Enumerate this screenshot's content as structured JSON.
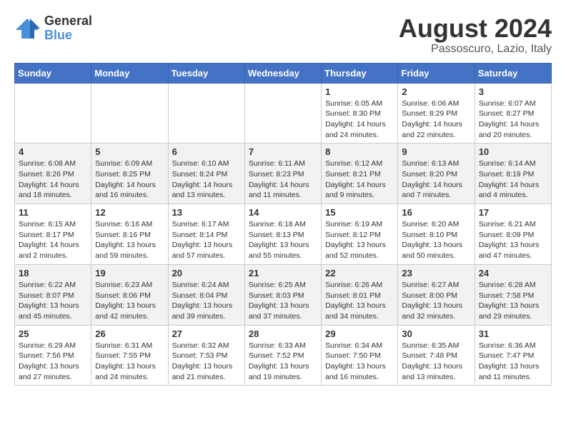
{
  "logo": {
    "general": "General",
    "blue": "Blue"
  },
  "title": "August 2024",
  "location": "Passoscuro, Lazio, Italy",
  "weekdays": [
    "Sunday",
    "Monday",
    "Tuesday",
    "Wednesday",
    "Thursday",
    "Friday",
    "Saturday"
  ],
  "weeks": [
    [
      {
        "day": "",
        "info": ""
      },
      {
        "day": "",
        "info": ""
      },
      {
        "day": "",
        "info": ""
      },
      {
        "day": "",
        "info": ""
      },
      {
        "day": "1",
        "info": "Sunrise: 6:05 AM\nSunset: 8:30 PM\nDaylight: 14 hours and 24 minutes."
      },
      {
        "day": "2",
        "info": "Sunrise: 6:06 AM\nSunset: 8:29 PM\nDaylight: 14 hours and 22 minutes."
      },
      {
        "day": "3",
        "info": "Sunrise: 6:07 AM\nSunset: 8:27 PM\nDaylight: 14 hours and 20 minutes."
      }
    ],
    [
      {
        "day": "4",
        "info": "Sunrise: 6:08 AM\nSunset: 8:26 PM\nDaylight: 14 hours and 18 minutes."
      },
      {
        "day": "5",
        "info": "Sunrise: 6:09 AM\nSunset: 8:25 PM\nDaylight: 14 hours and 16 minutes."
      },
      {
        "day": "6",
        "info": "Sunrise: 6:10 AM\nSunset: 8:24 PM\nDaylight: 14 hours and 13 minutes."
      },
      {
        "day": "7",
        "info": "Sunrise: 6:11 AM\nSunset: 8:23 PM\nDaylight: 14 hours and 11 minutes."
      },
      {
        "day": "8",
        "info": "Sunrise: 6:12 AM\nSunset: 8:21 PM\nDaylight: 14 hours and 9 minutes."
      },
      {
        "day": "9",
        "info": "Sunrise: 6:13 AM\nSunset: 8:20 PM\nDaylight: 14 hours and 7 minutes."
      },
      {
        "day": "10",
        "info": "Sunrise: 6:14 AM\nSunset: 8:19 PM\nDaylight: 14 hours and 4 minutes."
      }
    ],
    [
      {
        "day": "11",
        "info": "Sunrise: 6:15 AM\nSunset: 8:17 PM\nDaylight: 14 hours and 2 minutes."
      },
      {
        "day": "12",
        "info": "Sunrise: 6:16 AM\nSunset: 8:16 PM\nDaylight: 13 hours and 59 minutes."
      },
      {
        "day": "13",
        "info": "Sunrise: 6:17 AM\nSunset: 8:14 PM\nDaylight: 13 hours and 57 minutes."
      },
      {
        "day": "14",
        "info": "Sunrise: 6:18 AM\nSunset: 8:13 PM\nDaylight: 13 hours and 55 minutes."
      },
      {
        "day": "15",
        "info": "Sunrise: 6:19 AM\nSunset: 8:12 PM\nDaylight: 13 hours and 52 minutes."
      },
      {
        "day": "16",
        "info": "Sunrise: 6:20 AM\nSunset: 8:10 PM\nDaylight: 13 hours and 50 minutes."
      },
      {
        "day": "17",
        "info": "Sunrise: 6:21 AM\nSunset: 8:09 PM\nDaylight: 13 hours and 47 minutes."
      }
    ],
    [
      {
        "day": "18",
        "info": "Sunrise: 6:22 AM\nSunset: 8:07 PM\nDaylight: 13 hours and 45 minutes."
      },
      {
        "day": "19",
        "info": "Sunrise: 6:23 AM\nSunset: 8:06 PM\nDaylight: 13 hours and 42 minutes."
      },
      {
        "day": "20",
        "info": "Sunrise: 6:24 AM\nSunset: 8:04 PM\nDaylight: 13 hours and 39 minutes."
      },
      {
        "day": "21",
        "info": "Sunrise: 6:25 AM\nSunset: 8:03 PM\nDaylight: 13 hours and 37 minutes."
      },
      {
        "day": "22",
        "info": "Sunrise: 6:26 AM\nSunset: 8:01 PM\nDaylight: 13 hours and 34 minutes."
      },
      {
        "day": "23",
        "info": "Sunrise: 6:27 AM\nSunset: 8:00 PM\nDaylight: 13 hours and 32 minutes."
      },
      {
        "day": "24",
        "info": "Sunrise: 6:28 AM\nSunset: 7:58 PM\nDaylight: 13 hours and 29 minutes."
      }
    ],
    [
      {
        "day": "25",
        "info": "Sunrise: 6:29 AM\nSunset: 7:56 PM\nDaylight: 13 hours and 27 minutes."
      },
      {
        "day": "26",
        "info": "Sunrise: 6:31 AM\nSunset: 7:55 PM\nDaylight: 13 hours and 24 minutes."
      },
      {
        "day": "27",
        "info": "Sunrise: 6:32 AM\nSunset: 7:53 PM\nDaylight: 13 hours and 21 minutes."
      },
      {
        "day": "28",
        "info": "Sunrise: 6:33 AM\nSunset: 7:52 PM\nDaylight: 13 hours and 19 minutes."
      },
      {
        "day": "29",
        "info": "Sunrise: 6:34 AM\nSunset: 7:50 PM\nDaylight: 13 hours and 16 minutes."
      },
      {
        "day": "30",
        "info": "Sunrise: 6:35 AM\nSunset: 7:48 PM\nDaylight: 13 hours and 13 minutes."
      },
      {
        "day": "31",
        "info": "Sunrise: 6:36 AM\nSunset: 7:47 PM\nDaylight: 13 hours and 11 minutes."
      }
    ]
  ]
}
